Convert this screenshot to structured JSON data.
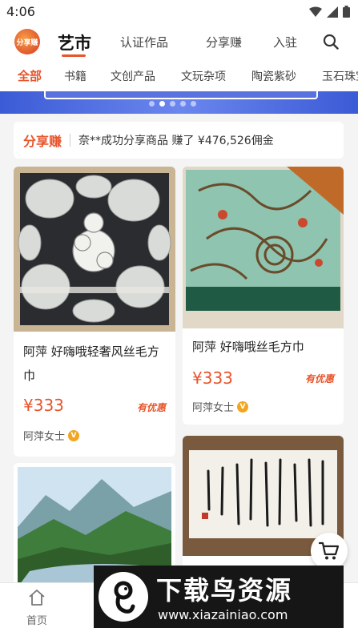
{
  "status_bar": {
    "time": "4:06"
  },
  "top_nav": {
    "logo_text": "分享赚",
    "tabs": [
      {
        "label": "艺市",
        "active": true
      },
      {
        "label": "认证作品",
        "active": false
      },
      {
        "label": "分享赚",
        "active": false
      },
      {
        "label": "入驻",
        "active": false
      }
    ]
  },
  "categories": [
    {
      "label": "全部",
      "active": true
    },
    {
      "label": "书籍",
      "active": false
    },
    {
      "label": "文创产品",
      "active": false
    },
    {
      "label": "文玩杂项",
      "active": false
    },
    {
      "label": "陶瓷紫砂",
      "active": false
    },
    {
      "label": "玉石珠宝",
      "active": false
    }
  ],
  "banner": {
    "dots": 5,
    "active_dot": 2
  },
  "share_ticker": {
    "title": "分享赚",
    "text": "奈**成功分享商品 赚了 ¥476,526佣金"
  },
  "products": [
    {
      "title": "阿萍 好嗨哦轻奢风丝毛方巾",
      "price": "¥333",
      "promo": "有优惠",
      "seller": "阿萍女士",
      "badge": "V"
    },
    {
      "title": "阿萍 好嗨哦丝毛方巾",
      "price": "¥333",
      "promo": "有优惠",
      "seller": "阿萍女士",
      "badge": "V"
    },
    {
      "title": ""
    },
    {
      "title": ""
    }
  ],
  "tab_bar": {
    "home_label": "首页"
  },
  "watermark": {
    "big_text": "下载鸟资源",
    "small_text": "www.xiazainiao.com"
  },
  "colors": {
    "accent": "#e8542b",
    "banner_blue": "#3b5bd6",
    "badge_gold": "#f3a51f"
  }
}
